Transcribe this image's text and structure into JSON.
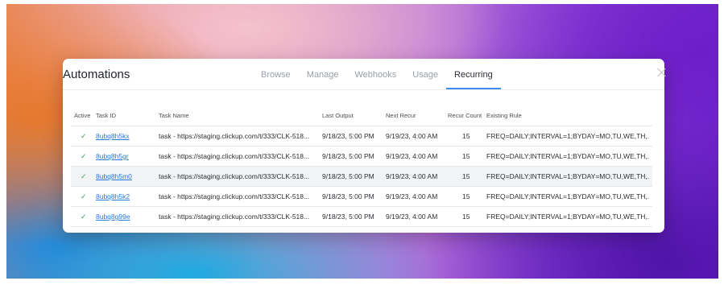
{
  "modal": {
    "title": "Automations",
    "tabs": [
      "Browse",
      "Manage",
      "Webhooks",
      "Usage",
      "Recurring"
    ],
    "active_tab": "Recurring"
  },
  "table": {
    "headers": {
      "active": "Active",
      "task_id": "Task ID",
      "task_name": "Task Name",
      "last_output": "Last Output",
      "next_recur": "Next Recur",
      "recur_count": "Recur Count",
      "existing_rule": "Existing Rule"
    },
    "rows": [
      {
        "active": "✓",
        "task_id": "8ubq8h5kx",
        "task_name": "task - https://staging.clickup.com/t/333/CLK-518...",
        "last_output": "9/18/23, 5:00 PM",
        "next_recur": "9/19/23, 4:00 AM",
        "recur_count": "15",
        "existing_rule": "FREQ=DAILY;INTERVAL=1;BYDAY=MO,TU,WE,TH,."
      },
      {
        "active": "✓",
        "task_id": "8ubq8h5gr",
        "task_name": "task - https://staging.clickup.com/t/333/CLK-518...",
        "last_output": "9/18/23, 5:00 PM",
        "next_recur": "9/19/23, 4:00 AM",
        "recur_count": "15",
        "existing_rule": "FREQ=DAILY;INTERVAL=1;BYDAY=MO,TU,WE,TH,."
      },
      {
        "active": "✓",
        "task_id": "8ubq8h5m0",
        "task_name": "task - https://staging.clickup.com/t/333/CLK-518...",
        "last_output": "9/18/23, 5:00 PM",
        "next_recur": "9/19/23, 4:00 AM",
        "recur_count": "15",
        "existing_rule": "FREQ=DAILY;INTERVAL=1;BYDAY=MO,TU,WE,TH,."
      },
      {
        "active": "✓",
        "task_id": "8ubq8h5k2",
        "task_name": "task - https://staging.clickup.com/t/333/CLK-518...",
        "last_output": "9/18/23, 5:00 PM",
        "next_recur": "9/19/23, 4:00 AM",
        "recur_count": "15",
        "existing_rule": "FREQ=DAILY;INTERVAL=1;BYDAY=MO,TU,WE,TH,."
      },
      {
        "active": "✓",
        "task_id": "8ubq8g99e",
        "task_name": "task - https://staging.clickup.com/t/333/CLK-518...",
        "last_output": "9/18/23, 5:00 PM",
        "next_recur": "9/19/23, 4:00 AM",
        "recur_count": "15",
        "existing_rule": "FREQ=DAILY;INTERVAL=1;BYDAY=MO,TU,WE,TH,."
      }
    ]
  },
  "colors": {
    "accent": "#3d8cf0",
    "link": "#2a78d6",
    "check": "#3aa55a"
  },
  "icons": {
    "close": "close-icon",
    "active_check": "checkmark-icon"
  }
}
